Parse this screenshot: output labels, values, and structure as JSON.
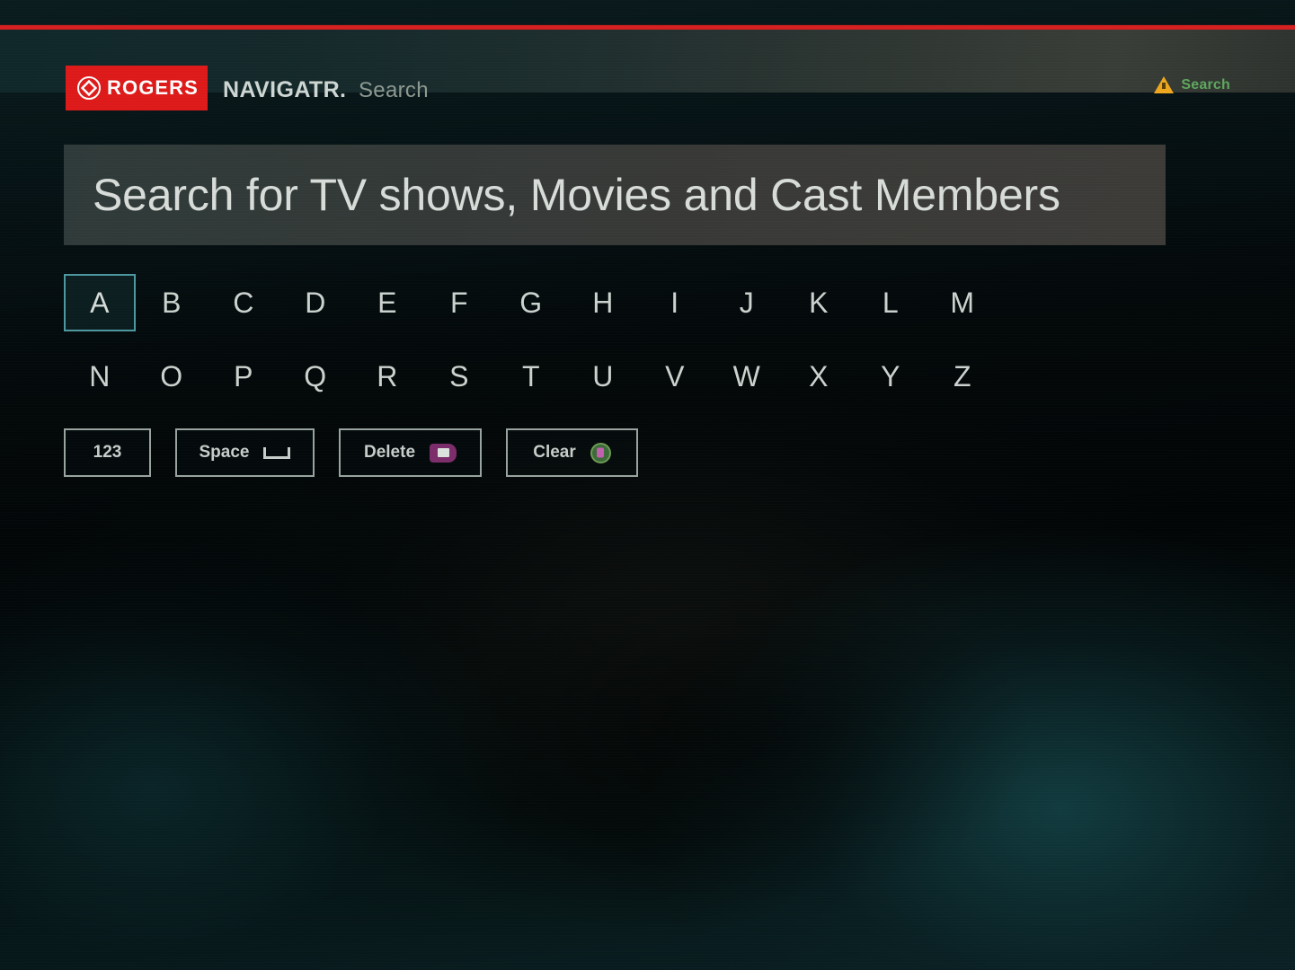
{
  "header": {
    "brand_badge": "ROGERS",
    "brand_mark_icon": "rogers-diamond-icon",
    "brand_product": "NAVIGATR.",
    "title": "Search",
    "right_icon": "warning-triangle-icon",
    "right_label": "Search"
  },
  "search": {
    "placeholder": "Search for TV shows, Movies and Cast Members",
    "value": ""
  },
  "keyboard": {
    "rows": [
      [
        "A",
        "B",
        "C",
        "D",
        "E",
        "F",
        "G",
        "H",
        "I",
        "J",
        "K",
        "L",
        "M"
      ],
      [
        "N",
        "O",
        "P",
        "Q",
        "R",
        "S",
        "T",
        "U",
        "V",
        "W",
        "X",
        "Y",
        "Z"
      ]
    ],
    "selected_key": "A"
  },
  "function_keys": [
    {
      "label": "123",
      "icon": ""
    },
    {
      "label": "Space",
      "icon": "spacebar-icon"
    },
    {
      "label": "Delete",
      "icon": "backspace-icon"
    },
    {
      "label": "Clear",
      "icon": "clear-circle-icon"
    }
  ],
  "colors": {
    "brand_red": "#e01a1a",
    "top_rule_red": "#d61f1f",
    "selection_teal": "#4e9aa0",
    "warning_amber": "#f0a81e",
    "accent_green": "#5fa85f"
  }
}
